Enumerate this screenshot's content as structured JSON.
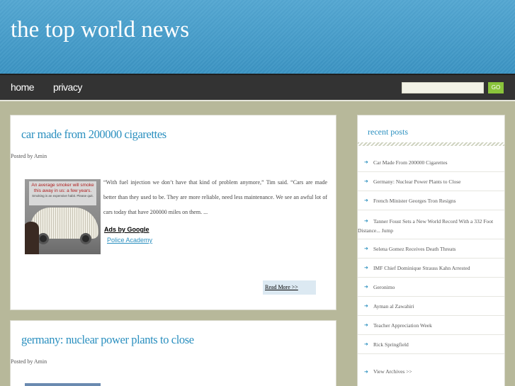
{
  "site": {
    "title": "the top world news"
  },
  "nav": {
    "home": "home",
    "privacy": "privacy"
  },
  "search": {
    "placeholder": "",
    "button": "GO"
  },
  "posts": [
    {
      "title": "car made from 200000 cigarettes",
      "posted_by": "Posted by Amin",
      "thumb_sign": "An average smoker will smoke this away in  us: a few years.",
      "thumb_sign_small": "Smoking is an expensive habit. Please quit.",
      "excerpt": "“With fuel injection we don’t have that kind of problem anymore,” Tim said. “Cars are made better than they used to be. They are more reliable, need less maintenance. We see an awful lot of cars today that have 200000 miles on them. ...",
      "ads_by": "Ads by Google",
      "ad_link": "Police Academy",
      "read_more": "Read More >>"
    },
    {
      "title": "germany: nuclear power plants to close",
      "posted_by": "Posted by Amin"
    }
  ],
  "sidebar": {
    "title": "recent posts",
    "items": [
      "Car Made From 200000 Cigarettes",
      "Germany: Nuclear Power Plants to Close",
      "French Minister Georges Tron Resigns",
      "Tanner Foust Sets a New World Record With a 332 Foot Distance... Jump",
      "Selena Gomez Receives Death Threats",
      "IMF Chief Dominique Strauss Kahn Arrested",
      "Geronimo",
      "Ayman al Zawahiri",
      "Teacher Appreciation Week",
      "Rick Springfield",
      "View Archives >>"
    ]
  },
  "colors": {
    "header": "#4a9fcc",
    "nav": "#333333",
    "accent": "#2a8fbf",
    "go_button": "#8ac43b",
    "page_bg": "#b7b89a"
  },
  "icons": {
    "list_arrow": "chevron-right-icon"
  }
}
